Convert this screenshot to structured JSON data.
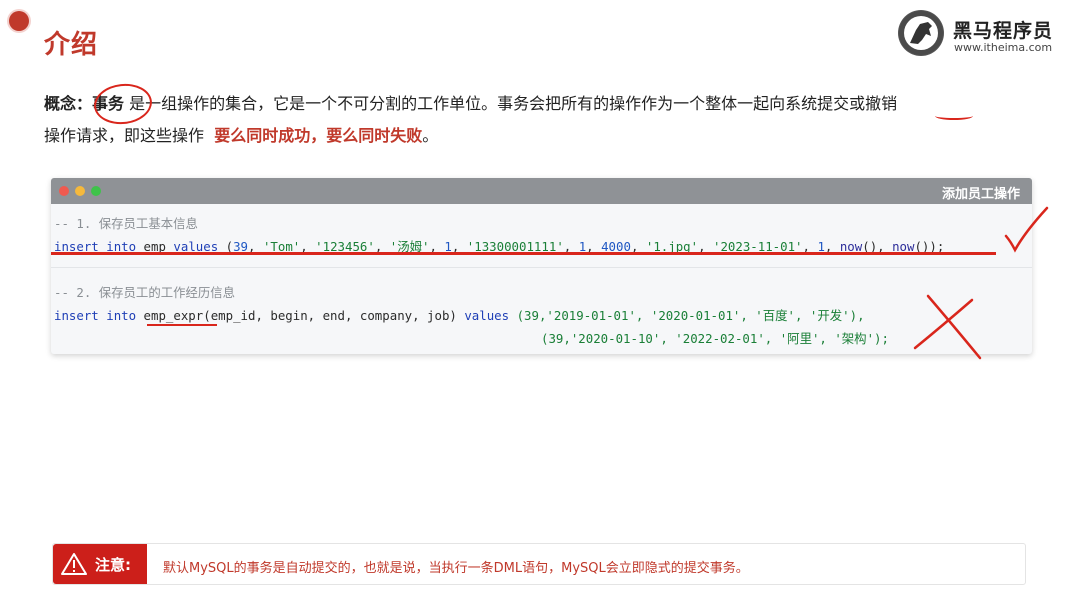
{
  "slide": {
    "title": "介绍"
  },
  "logo": {
    "name_cn": "黑马程序员",
    "url": "www.itheima.com"
  },
  "concept": {
    "label": "概念：",
    "keyword": "事务",
    "text_line1": "是一组操作的集合，它是一个不可分割的工作单位。事务会把所有的操作作为一个整体一起向系统提交或撤销",
    "text_line2_pre": "操作请求，即这些操作",
    "emphasis": "要么同时成功，要么同时失败",
    "text_line2_post": "。"
  },
  "code_window": {
    "title": "添加员工操作",
    "comment1": "-- 1. 保存员工基本信息",
    "line1": {
      "kw1": "insert",
      "kw2": "into",
      "table": "emp",
      "kw3": "values",
      "p0": " (",
      "v1": "39",
      "s1": "'Tom'",
      "s2": "'123456'",
      "s3": "'汤姆'",
      "v2": "1",
      "s4": "'13300001111'",
      "v3": "1",
      "v4": "4000",
      "s5": "'1.jpg'",
      "s6": "'2023-11-01'",
      "v5": "1",
      "f1": "now",
      "f2": "now",
      "end": "());"
    },
    "comment2": "-- 2. 保存员工的工作经历信息",
    "line2": {
      "kw1": "insert",
      "kw2": "into",
      "table": "emp_expr",
      "cols": "(emp_id, begin, end, company, job)",
      "kw3": "values",
      "row1": "(39,'2019-01-01', '2020-01-01', '百度', '开发'),",
      "row2": "(39,'2020-01-10', '2022-02-01', '阿里', '架构');"
    }
  },
  "note": {
    "label": "注意:",
    "text": "默认MySQL的事务是自动提交的，也就是说，当执行一条DML语句，MySQL会立即隐式的提交事务。"
  },
  "colors": {
    "accent_red": "#c0392b",
    "annotation_red": "#d9261c",
    "note_head": "#cc1f1a"
  }
}
